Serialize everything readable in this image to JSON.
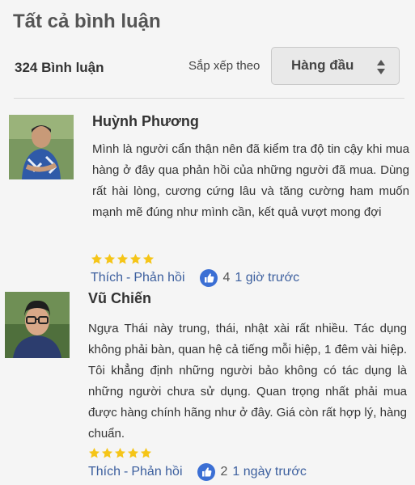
{
  "header": {
    "title": "Tất cả bình luận",
    "count": "324 Bình luận",
    "sort_label": "Sắp xếp theo",
    "sort_value": "Hàng đầu"
  },
  "reviews": [
    {
      "author": "Huỳnh Phương",
      "text": "Mình là người cẩn thận nên đã kiểm tra độ tin cậy khi mua hàng ở đây qua phản hồi của những người đã mua. Dùng rất hài lòng, cương cứng lâu và tăng cường ham muốn mạnh mẽ đúng như mình cần, kết quả vượt mong đợi",
      "rating": 5,
      "like_label": "Thích",
      "separator": "-",
      "reply_label": "Phản hồi",
      "likes": "4",
      "time": "1 giờ trước"
    },
    {
      "author": "Vũ Chiến",
      "text": "Ngựa Thái này trung, thái, nhật xài rất nhiều. Tác dụng không phải bàn, quan hệ cả tiếng mỗi hiệp, 1 đêm vài hiệp. Tôi khẳng định những người bảo không có tác dụng là những người chưa sử dụng. Quan trọng nhất phải mua được hàng chính hãng như ở đây. Giá còn rất hợp lý, hàng chuẩn.",
      "rating": 5,
      "like_label": "Thích",
      "separator": "-",
      "reply_label": "Phản hồi",
      "likes": "2",
      "time": "1 ngày trước"
    }
  ],
  "colors": {
    "star": "#f5c518",
    "link": "#3c5f9e",
    "like_badge": "#3b6fd4"
  },
  "icons": {
    "star": "star-icon",
    "like": "thumbs-up-icon",
    "sort": "sort-arrows-icon"
  }
}
